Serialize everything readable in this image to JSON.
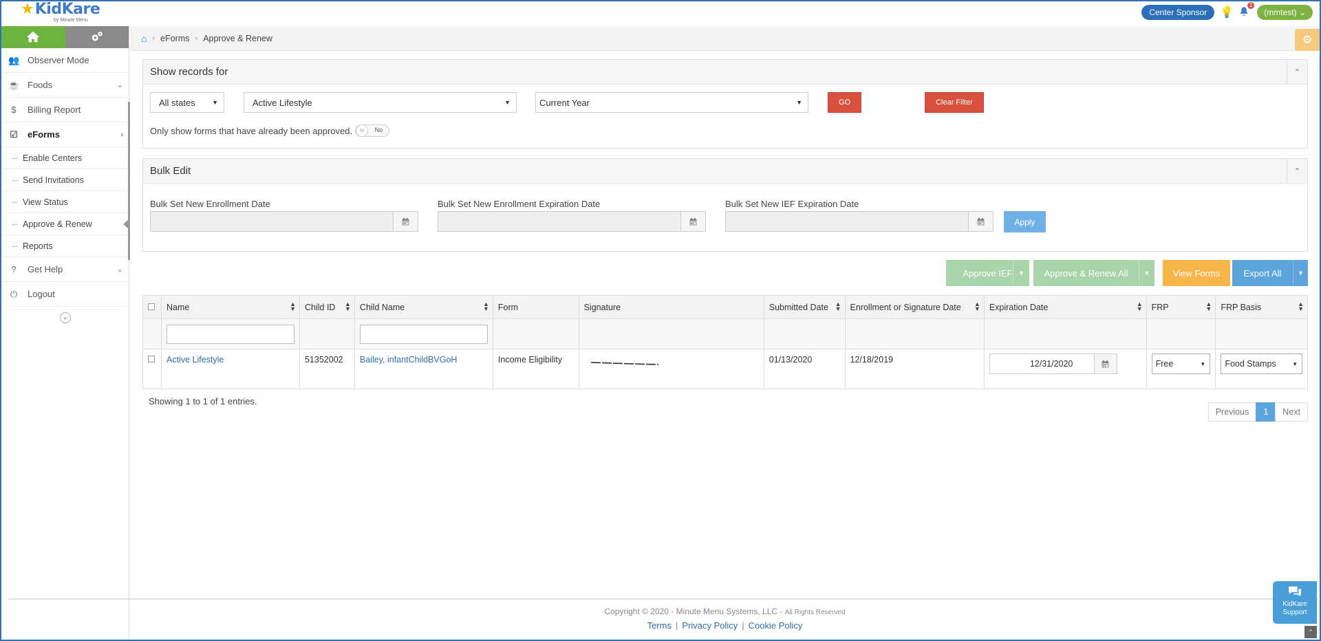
{
  "header": {
    "logo_text": "KidKare",
    "logo_sub": "by Minute Menu",
    "sponsor_label": "Center Sponsor",
    "notification_count": "1",
    "user_label": "(mmtest)"
  },
  "sidebar": {
    "items": [
      {
        "label": "Observer Mode"
      },
      {
        "label": "Foods"
      },
      {
        "label": "Billing Report"
      },
      {
        "label": "eForms"
      },
      {
        "label": "Get Help"
      },
      {
        "label": "Logout"
      }
    ],
    "eforms_sub": [
      {
        "label": "Enable Centers"
      },
      {
        "label": "Send Invitations"
      },
      {
        "label": "View Status"
      },
      {
        "label": "Approve & Renew"
      },
      {
        "label": "Reports"
      }
    ]
  },
  "breadcrumb": {
    "level1": "eForms",
    "level2": "Approve & Renew"
  },
  "filter_panel": {
    "title": "Show records for",
    "state_select": "All states",
    "center_select": "Active Lifestyle",
    "period_select": "Current Year",
    "go_label": "GO",
    "clear_label": "Clear Filter",
    "approved_only_label": "Only show forms that have already been approved.",
    "toggle_value": "No",
    "toggle_knob": "III"
  },
  "bulk_panel": {
    "title": "Bulk Edit",
    "enrollment_date_label": "Bulk Set New Enrollment Date",
    "enrollment_exp_label": "Bulk Set New Enrollment Expiration Date",
    "ief_exp_label": "Bulk Set New IEF Expiration Date",
    "apply_label": "Apply"
  },
  "actions": {
    "approve_ief": "Approve IEF",
    "approve_renew_all": "Approve & Renew All",
    "view_forms": "View Forms",
    "export_all": "Export All"
  },
  "table": {
    "columns": [
      "Name",
      "Child ID",
      "Child Name",
      "Form",
      "Signature",
      "Submitted Date",
      "Enrollment or Signature Date",
      "Expiration Date",
      "FRP",
      "FRP Basis"
    ],
    "rows": [
      {
        "name": "Active Lifestyle",
        "child_id": "51352002",
        "child_name": "Bailey, infantChildBVGoH",
        "form": "Income Eligibility",
        "submitted_date": "01/13/2020",
        "enrollment_date": "12/18/2019",
        "expiration_date": "12/31/2020",
        "frp": "Free",
        "frp_basis": "Food Stamps"
      }
    ]
  },
  "pagination": {
    "showing_text": "Showing 1 to 1 of 1 entries.",
    "previous": "Previous",
    "page": "1",
    "next": "Next"
  },
  "footer": {
    "copyright": "Copyright © 2020 - Minute Menu Systems, LLC -",
    "rights": "All Rights Reserved",
    "terms": "Terms",
    "privacy": "Privacy Policy",
    "cookie": "Cookie Policy"
  },
  "support": {
    "line1": "KidKare",
    "line2": "Support"
  },
  "colors": {
    "brand_blue": "#2a6fb8",
    "home_green": "#6cb33f",
    "go_red": "#d9503f",
    "export_blue": "#5ba4dc",
    "view_orange": "#f8b54a"
  }
}
